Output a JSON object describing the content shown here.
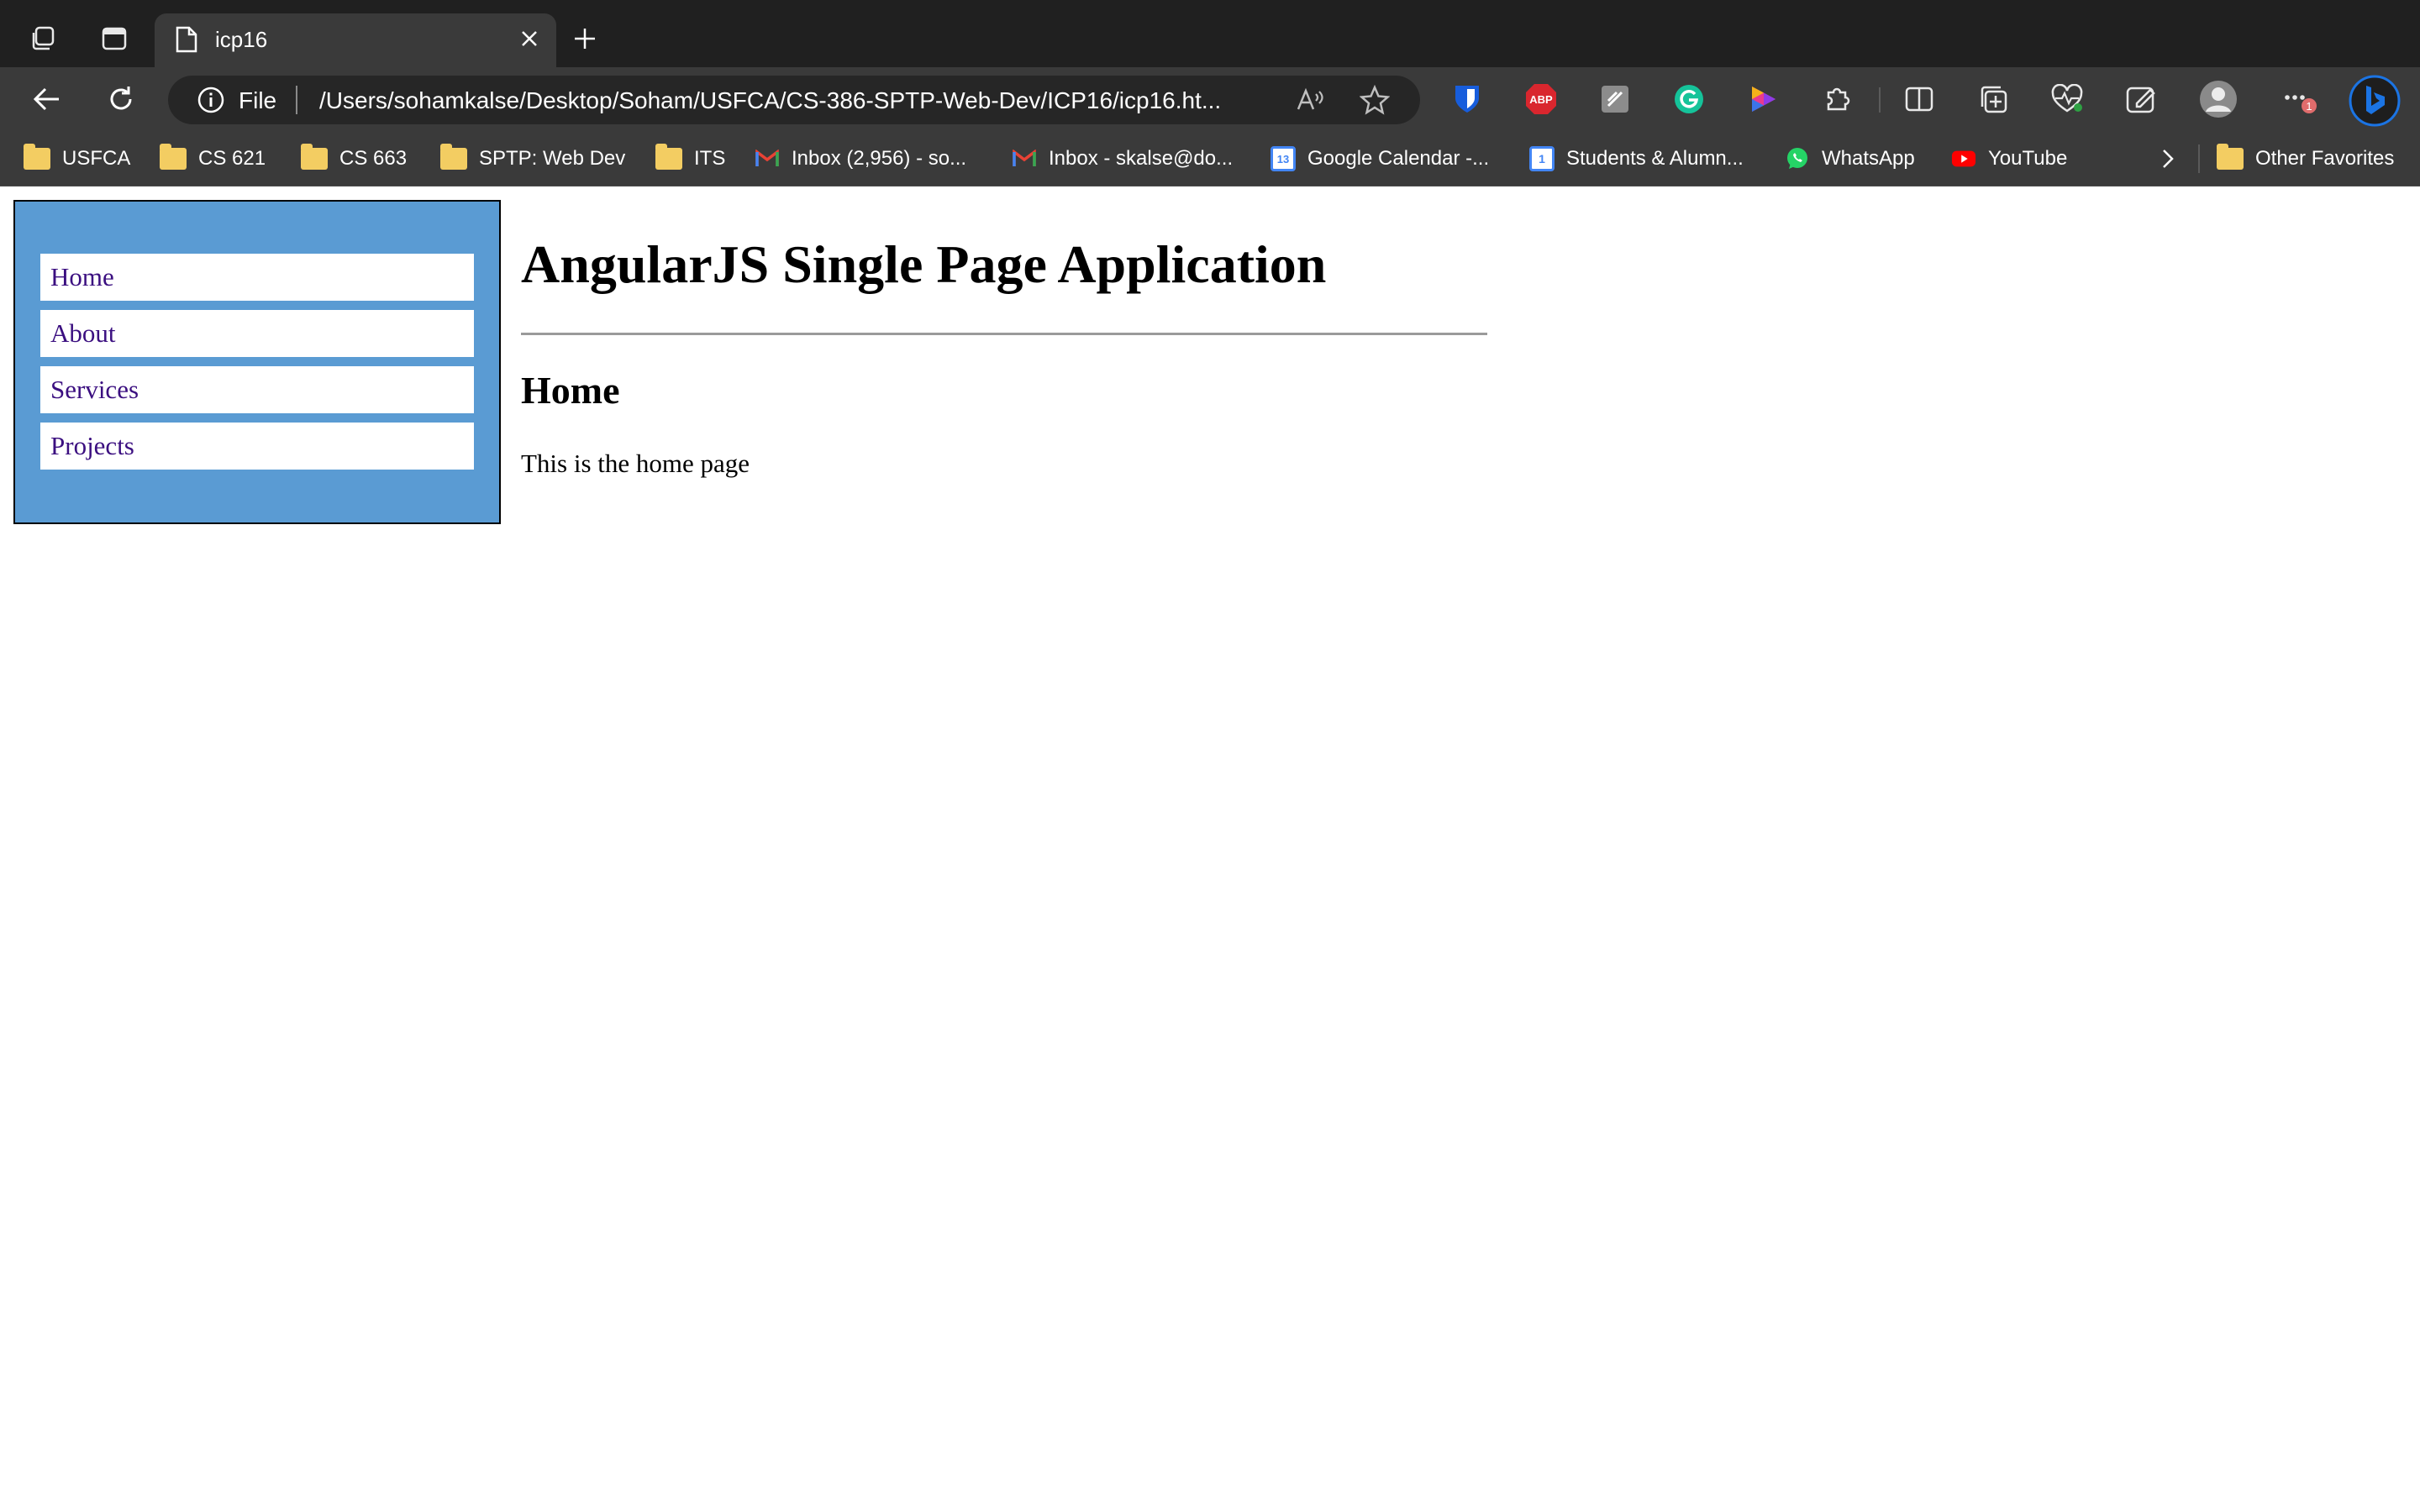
{
  "browser": {
    "tab": {
      "title": "icp16"
    },
    "omnibox": {
      "scheme": "File",
      "url": "/Users/sohamkalse/Desktop/Soham/USFCA/CS-386-SPTP-Web-Dev/ICP16/icp16.ht..."
    },
    "bookmarks": [
      {
        "label": "USFCA",
        "icon": "folder-icon"
      },
      {
        "label": "CS 621",
        "icon": "folder-icon"
      },
      {
        "label": "CS 663",
        "icon": "folder-icon"
      },
      {
        "label": "SPTP: Web Dev",
        "icon": "folder-icon"
      },
      {
        "label": "ITS",
        "icon": "folder-icon"
      },
      {
        "label": "Inbox (2,956) - so...",
        "icon": "gmail-icon"
      },
      {
        "label": "Inbox - skalse@do...",
        "icon": "gmail-icon"
      },
      {
        "label": "Google Calendar -...",
        "icon": "calendar-icon",
        "badge": "13"
      },
      {
        "label": "Students & Alumn...",
        "icon": "calendar-icon",
        "badge": "1"
      },
      {
        "label": "WhatsApp",
        "icon": "whatsapp-icon"
      },
      {
        "label": "YouTube",
        "icon": "youtube-icon"
      }
    ],
    "other_favorites": "Other Favorites",
    "extensions": {
      "abp_label": "ABP",
      "notification_count": "1"
    }
  },
  "page": {
    "nav": [
      {
        "label": "Home"
      },
      {
        "label": "About"
      },
      {
        "label": "Services"
      },
      {
        "label": "Projects"
      }
    ],
    "title": "AngularJS Single Page Application",
    "view": {
      "heading": "Home",
      "text": "This is the home page"
    }
  },
  "colors": {
    "chrome_dark": "#202020",
    "chrome_toolbar": "#3a3a3a",
    "nav_bg": "#5a9bd3",
    "link": "#3b0f80"
  }
}
